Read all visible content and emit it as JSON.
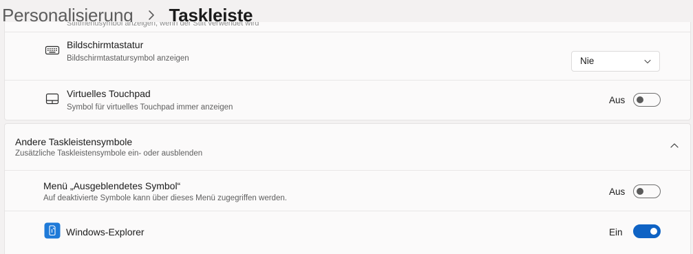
{
  "breadcrumb": {
    "parent": "Personalisierung",
    "current": "Taskleiste"
  },
  "top_card": {
    "cut_off_text": "Stiftmenüsymbol anzeigen, wenn der Stift verwendet wird",
    "rows": [
      {
        "title": "Bildschirmtastatur",
        "subtitle": "Bildschirmtastatursymbol anzeigen",
        "icon": "keyboard-icon",
        "control": "dropdown",
        "value": "Nie"
      },
      {
        "title": "Virtuelles Touchpad",
        "subtitle": "Symbol für virtuelles Touchpad immer anzeigen",
        "icon": "touchpad-icon",
        "control": "toggle",
        "state_label": "Aus",
        "on": false
      }
    ]
  },
  "section": {
    "title": "Andere Taskleistensymbole",
    "subtitle": "Zusätzliche Taskleistensymbole ein- oder ausblenden",
    "expanded": true,
    "icon": "chevron-up-icon",
    "rows": [
      {
        "title": "Menü „Ausgeblendetes Symbol“",
        "subtitle": "Auf deaktivierte Symbole kann über dieses Menü zugegriffen werden.",
        "control": "toggle",
        "state_label": "Aus",
        "on": false
      },
      {
        "title": "Windows-Explorer",
        "icon": "windows-explorer-icon",
        "control": "toggle",
        "state_label": "Ein",
        "on": true
      }
    ]
  },
  "colors": {
    "accent": "#0f63c4",
    "background": "#f3f1f1",
    "card": "#fbfafa"
  }
}
